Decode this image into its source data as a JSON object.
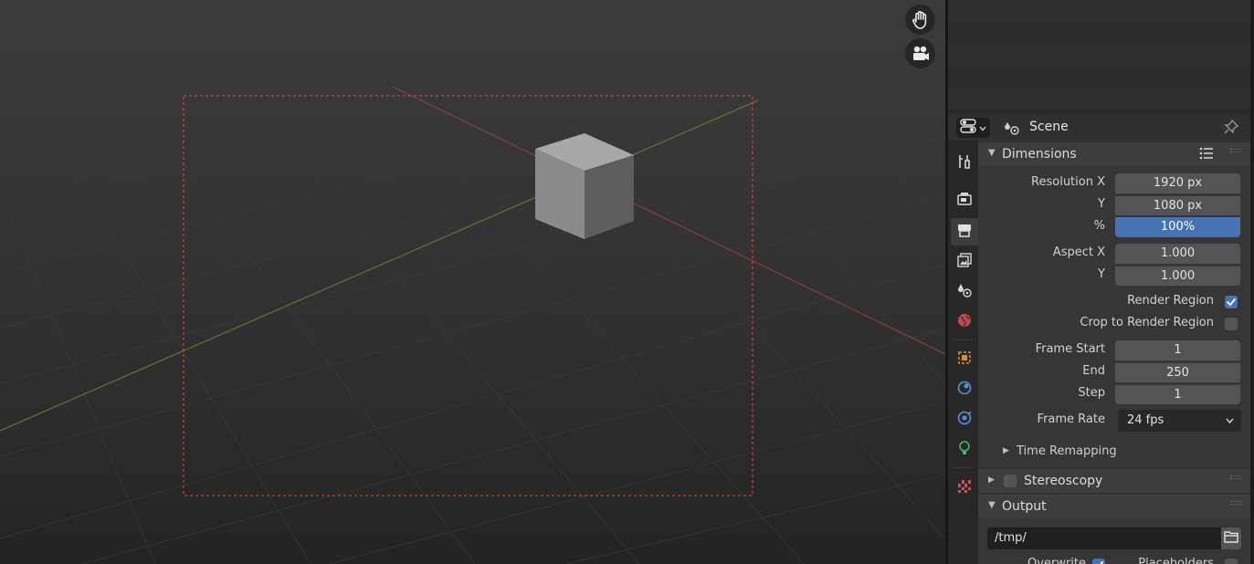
{
  "properties": {
    "header": {
      "scene_name": "Scene"
    },
    "dimensions": {
      "title": "Dimensions",
      "resolution_x_label": "Resolution X",
      "resolution_x_value": "1920 px",
      "resolution_y_label": "Y",
      "resolution_y_value": "1080 px",
      "percent_label": "%",
      "percent_value": "100%",
      "aspect_x_label": "Aspect X",
      "aspect_x_value": "1.000",
      "aspect_y_label": "Y",
      "aspect_y_value": "1.000",
      "render_region_label": "Render Region",
      "render_region_checked": true,
      "crop_label": "Crop to Render Region",
      "crop_checked": false,
      "frame_start_label": "Frame Start",
      "frame_start_value": "1",
      "frame_end_label": "End",
      "frame_end_value": "250",
      "frame_step_label": "Step",
      "frame_step_value": "1",
      "frame_rate_label": "Frame Rate",
      "frame_rate_value": "24 fps",
      "time_remapping_label": "Time Remapping"
    },
    "stereoscopy": {
      "title": "Stereoscopy",
      "checked": false
    },
    "output": {
      "title": "Output",
      "path": "/tmp/",
      "overwrite_label": "Overwrite",
      "overwrite_checked": true,
      "placeholders_label": "Placeholders",
      "placeholders_checked": false
    }
  },
  "colors": {
    "accent_blue": "#4772b3",
    "render_border": "#e04848",
    "x_axis": "#8c3d3d",
    "y_axis": "#6b7a2e"
  },
  "icons": {
    "viewport": [
      "hand-icon",
      "camera-icon"
    ],
    "tabs": [
      "tool-icon",
      "render-icon",
      "output-icon",
      "view-layer-icon",
      "scene-icon",
      "world-icon",
      "object-icon",
      "modifier-icon",
      "physics-icon",
      "constraint-icon",
      "data-light-icon",
      "texture-icon"
    ]
  }
}
